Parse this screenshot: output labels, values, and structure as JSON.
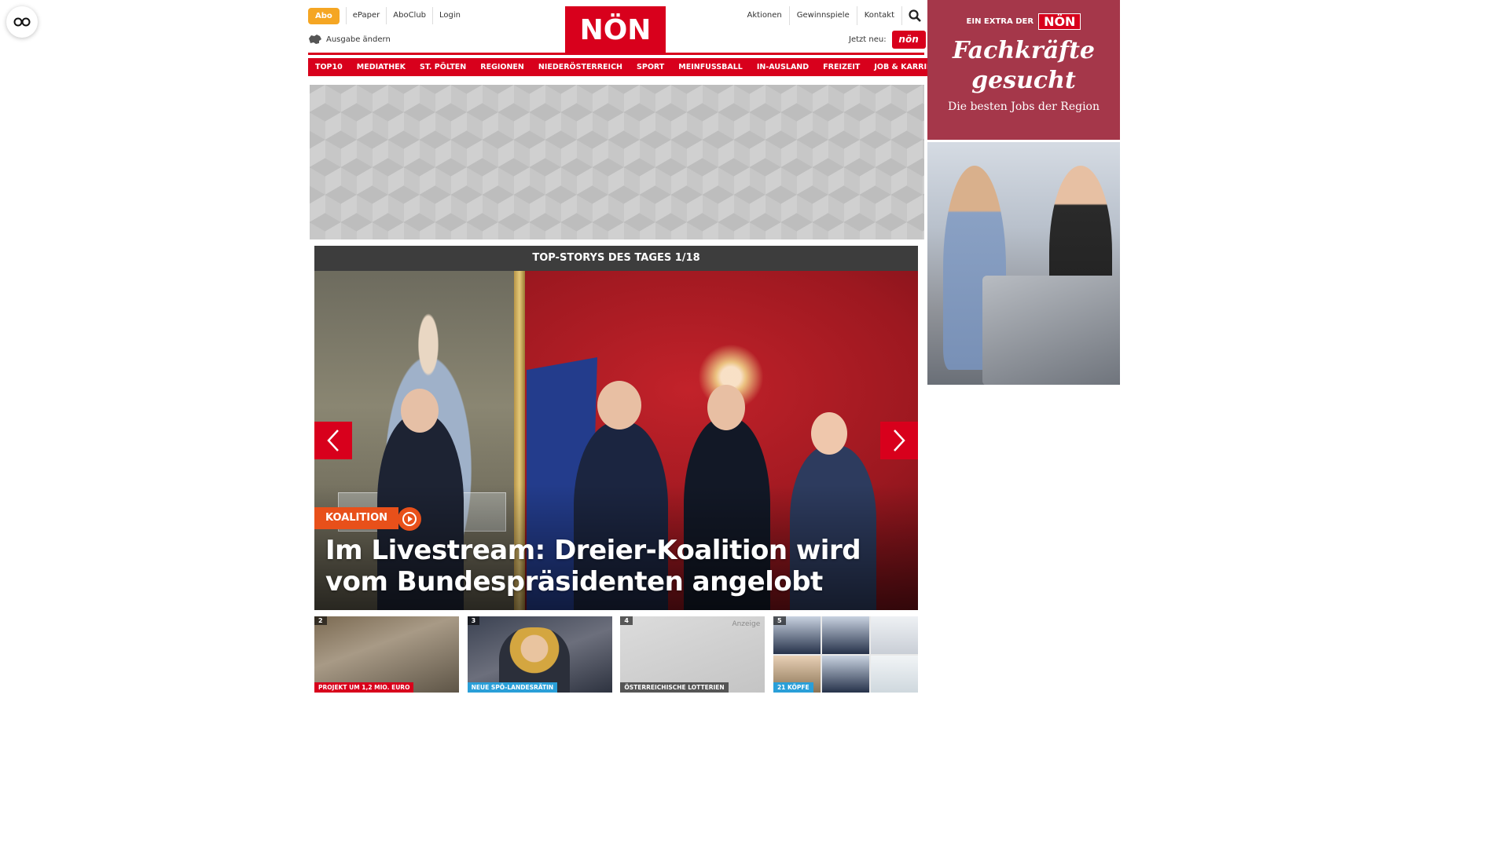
{
  "header": {
    "abo_label": "Abo",
    "top_links": [
      "ePaper",
      "AboClub",
      "Login"
    ],
    "edition_label": "Ausgabe ändern",
    "logo_text": "NÖN",
    "right_links": [
      "Aktionen",
      "Gewinnspiele",
      "Kontakt"
    ],
    "jetzt_label": "Jetzt neu:",
    "jetzt_badge": "nön",
    "brand_color": "#d8001c"
  },
  "nav": {
    "items": [
      "TOP10",
      "MEDIATHEK",
      "ST. PÖLTEN",
      "REGIONEN",
      "NIEDERÖSTERREICH",
      "SPORT",
      "MEINFUSSBALL",
      "IN-AUSLAND",
      "FREIZEIT",
      "JOB & KARRIERE"
    ]
  },
  "carousel": {
    "heading": "TOP-STORYS DES TAGES 1/18",
    "kicker": "KOALITION",
    "headline": "Im Livestream: Dreier-Koalition wird vom Bundespräsidenten angelobt",
    "kicker_color": "#e8501a"
  },
  "teasers": [
    {
      "num": "2",
      "tag": "PROJEKT UM 1,2 MIO. EURO",
      "tag_color": "#d8001c",
      "anzeige": ""
    },
    {
      "num": "3",
      "tag": "NEUE SPÖ-LANDESRÄTIN",
      "tag_color": "#2a9fd8",
      "anzeige": ""
    },
    {
      "num": "4",
      "tag": "ÖSTERREICHISCHE LOTTERIEN",
      "tag_color": "#555555",
      "anzeige": "Anzeige"
    },
    {
      "num": "5",
      "tag": "21 KÖPFE",
      "tag_color": "#2a9fd8",
      "anzeige": ""
    }
  ],
  "right_ad": {
    "brand_prefix": "EIN EXTRA DER",
    "brand_logo": "NÖN",
    "title_line1": "Fachkräfte",
    "title_line2": "gesucht",
    "subtitle": "Die besten Jobs der Region"
  },
  "icons": {
    "accessibility": "glasses-icon",
    "search": "search-icon",
    "edition": "map-icon",
    "prev": "chevron-left-icon",
    "next": "chevron-right-icon",
    "play": "play-icon"
  }
}
